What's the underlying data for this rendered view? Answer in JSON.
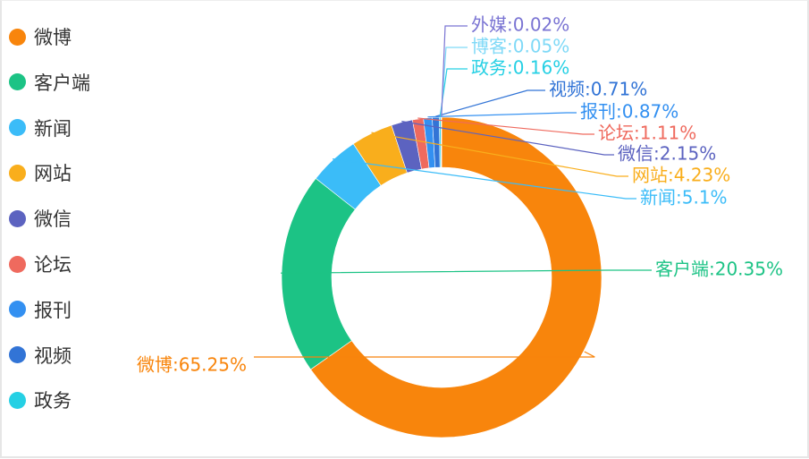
{
  "chart_data": {
    "type": "pie",
    "variant": "donut",
    "title": "",
    "start_angle_deg": 90,
    "direction": "clockwise",
    "legend_position": "left",
    "label_format": "{name}:{value}%",
    "slices": [
      {
        "name": "微博",
        "value": 65.25,
        "color": "#f8850c"
      },
      {
        "name": "客户端",
        "value": 20.35,
        "color": "#1cc385"
      },
      {
        "name": "新闻",
        "value": 5.1,
        "color": "#3bbcf8"
      },
      {
        "name": "网站",
        "value": 4.23,
        "color": "#f9ae1c"
      },
      {
        "name": "微信",
        "value": 2.15,
        "color": "#5c63c0"
      },
      {
        "name": "论坛",
        "value": 1.11,
        "color": "#ef6a5e"
      },
      {
        "name": "报刊",
        "value": 0.87,
        "color": "#3390f1"
      },
      {
        "name": "视频",
        "value": 0.71,
        "color": "#3274d6"
      },
      {
        "name": "政务",
        "value": 0.16,
        "color": "#25d0e4"
      },
      {
        "name": "博客",
        "value": 0.05,
        "color": "#7fd9f7"
      },
      {
        "name": "外媒",
        "value": 0.02,
        "color": "#7a74d3"
      }
    ],
    "legend": [
      "微博",
      "客户端",
      "新闻",
      "网站",
      "微信",
      "论坛",
      "报刊",
      "视频",
      "政务"
    ]
  }
}
